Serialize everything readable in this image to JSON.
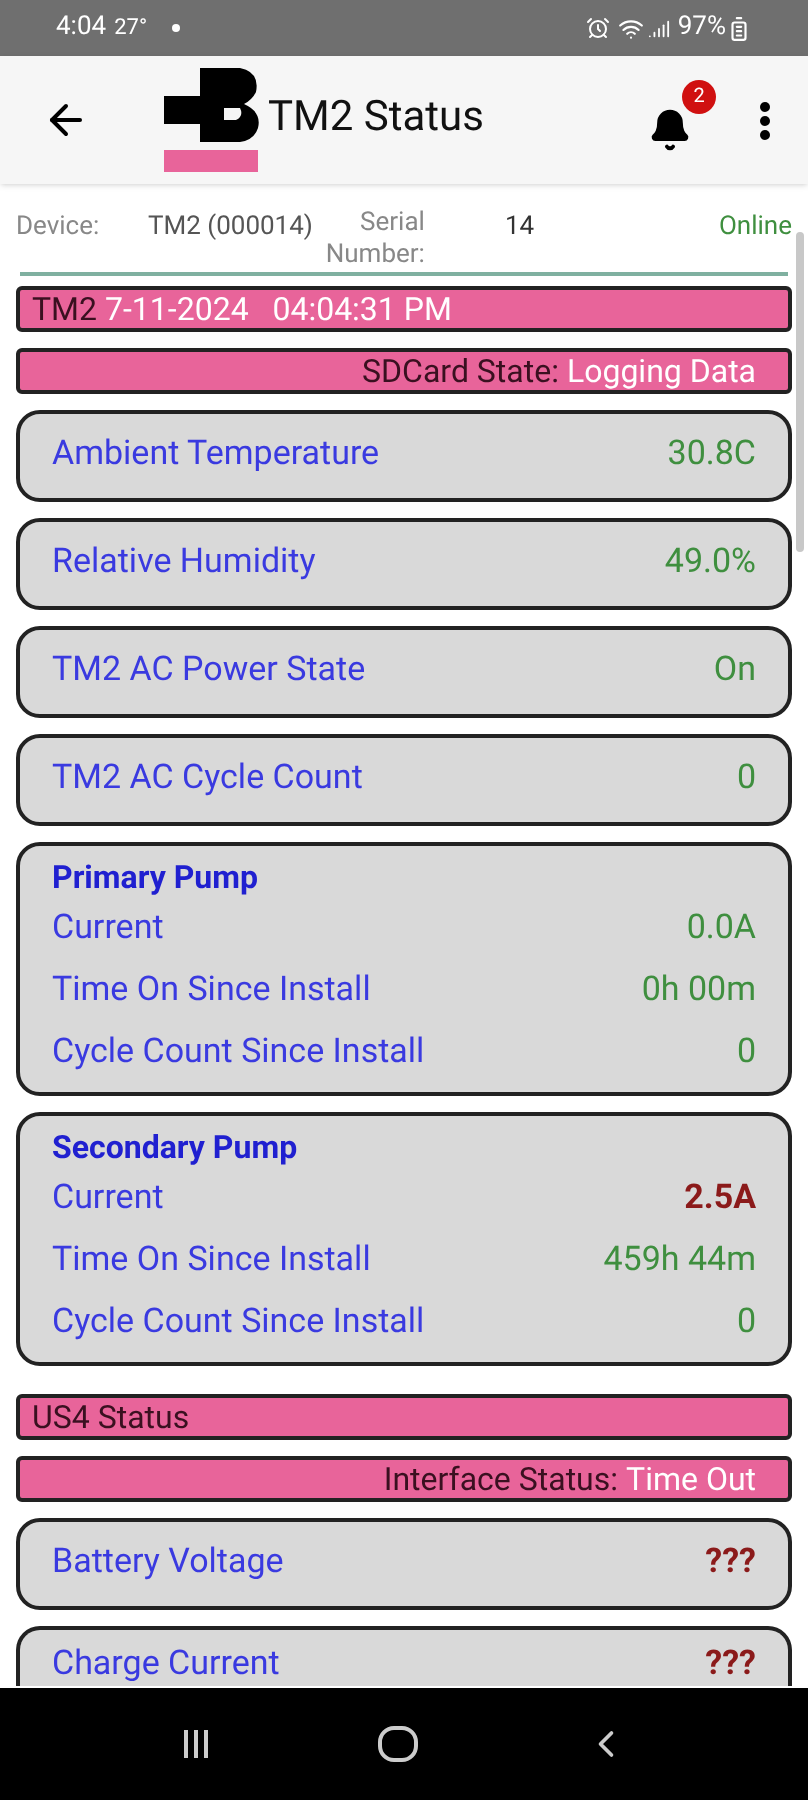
{
  "status_bar": {
    "time": "4:04",
    "temperature": "27°",
    "battery": "97%"
  },
  "app_bar": {
    "title": "TM2 Status",
    "notification_count": "2"
  },
  "device": {
    "device_label": "Device:",
    "device_value": "TM2 (000014)",
    "serial_label": "Serial Number:",
    "serial_value": "14",
    "connection": "Online"
  },
  "tm2_header": {
    "label": "TM2",
    "value": "7-11-2024   04:04:31 PM"
  },
  "sd_card": {
    "label": "SDCard State:",
    "value": "Logging Data"
  },
  "tm2_cards": [
    {
      "label": "Ambient Temperature",
      "value": "30.8C",
      "alert": false
    },
    {
      "label": "Relative Humidity",
      "value": "49.0%",
      "alert": false
    },
    {
      "label": "TM2 AC Power State",
      "value": "On",
      "alert": false
    },
    {
      "label": "TM2 AC Cycle Count",
      "value": "0",
      "alert": false
    }
  ],
  "pumps": [
    {
      "title": "Primary Pump",
      "rows": [
        {
          "label": "Current",
          "value": "0.0A",
          "alert": false
        },
        {
          "label": "Time On Since Install",
          "value": "0h 00m",
          "alert": false
        },
        {
          "label": "Cycle Count Since Install",
          "value": "0",
          "alert": false
        }
      ]
    },
    {
      "title": "Secondary Pump",
      "rows": [
        {
          "label": "Current",
          "value": "2.5A",
          "alert": true
        },
        {
          "label": "Time On Since Install",
          "value": "459h 44m",
          "alert": false
        },
        {
          "label": "Cycle Count Since Install",
          "value": "0",
          "alert": false
        }
      ]
    }
  ],
  "us4_header": {
    "label": "US4 Status"
  },
  "interface": {
    "label": "Interface Status:",
    "value": "Time Out"
  },
  "us4_cards": [
    {
      "label": "Battery Voltage",
      "value": "???",
      "alert": true
    },
    {
      "label": "Charge Current",
      "value": "???",
      "alert": true
    }
  ]
}
